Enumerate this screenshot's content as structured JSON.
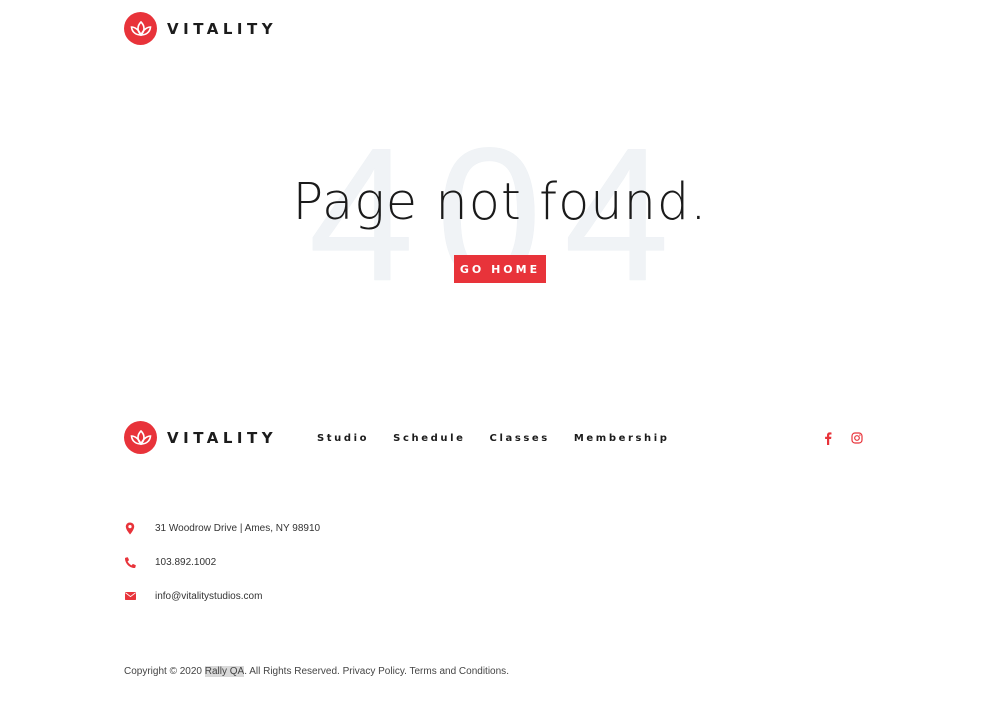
{
  "brand": {
    "name": "VITALITY",
    "accent_color": "#e8333a"
  },
  "hero": {
    "background_number": "404",
    "title": "Page not found.",
    "button_label": "GO HOME"
  },
  "footer": {
    "nav": [
      {
        "label": "Studio"
      },
      {
        "label": "Schedule"
      },
      {
        "label": "Classes"
      },
      {
        "label": "Membership"
      }
    ],
    "social": [
      {
        "icon": "facebook-icon"
      },
      {
        "icon": "instagram-icon"
      }
    ],
    "contact": [
      {
        "icon": "map-pin-icon",
        "text": "31 Woodrow Drive | Ames, NY 98910"
      },
      {
        "icon": "phone-icon",
        "text": "103.892.1002"
      },
      {
        "icon": "envelope-icon",
        "text": "info@vitalitystudios.com"
      }
    ],
    "copyright": {
      "prefix": "Copyright © 2020 ",
      "company": "Rally QA",
      "suffix": ". All Rights Reserved. ",
      "privacy": "Privacy Policy",
      "sep": ". ",
      "terms": "Terms and Conditions",
      "end": "."
    }
  }
}
